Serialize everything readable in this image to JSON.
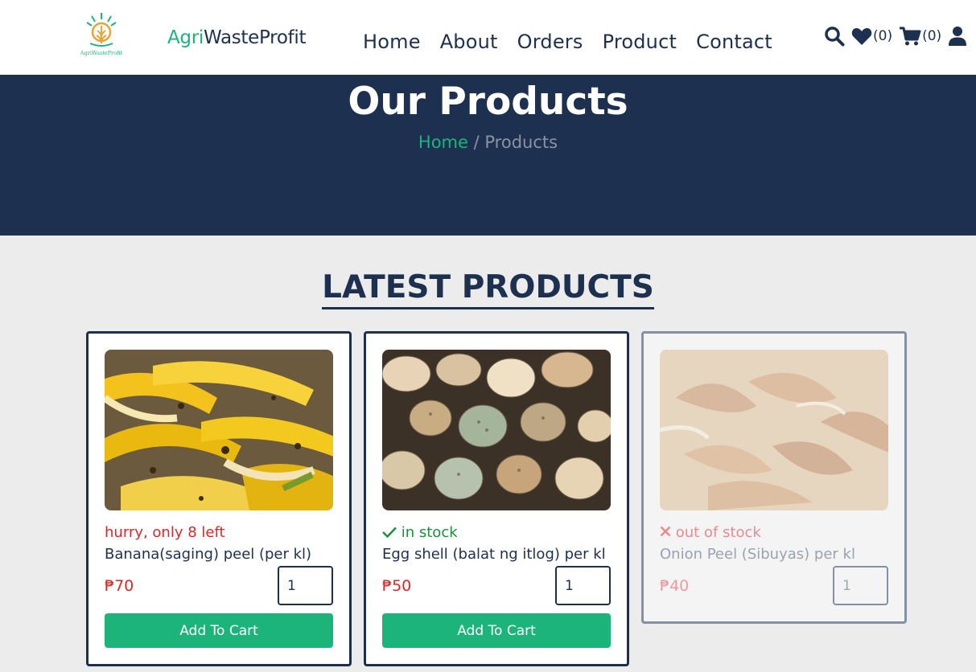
{
  "header": {
    "brand_accent": "Agri",
    "brand_rest": "WasteProfit",
    "nav": [
      "Home",
      "About",
      "Orders",
      "Product",
      "Contact"
    ],
    "wishlist_count": "(0)",
    "cart_count": "(0)",
    "icons": [
      "search-icon",
      "heart-icon",
      "cart-icon",
      "user-icon"
    ]
  },
  "hero": {
    "title": "Our Products",
    "breadcrumb_home": "Home",
    "breadcrumb_sep": " / ",
    "breadcrumb_current": "Products"
  },
  "section": {
    "title": "LATEST PRODUCTS"
  },
  "products": [
    {
      "stock": "hurry, only 8 left",
      "name": "Banana(saging) peel (per kl)",
      "price": "₱70",
      "qty": "1",
      "button": "Add To Cart"
    },
    {
      "stock": "in stock",
      "name": "Egg shell (balat ng itlog) per kl",
      "price": "₱50",
      "qty": "1",
      "button": "Add To Cart"
    },
    {
      "stock": "out of stock",
      "name": "Onion Peel (Sibuyas) per kl",
      "price": "₱40",
      "qty": "1"
    }
  ],
  "colors": {
    "navy": "#1d3050",
    "green": "#1db47c",
    "red": "#dc2727",
    "background": "#ececec"
  }
}
